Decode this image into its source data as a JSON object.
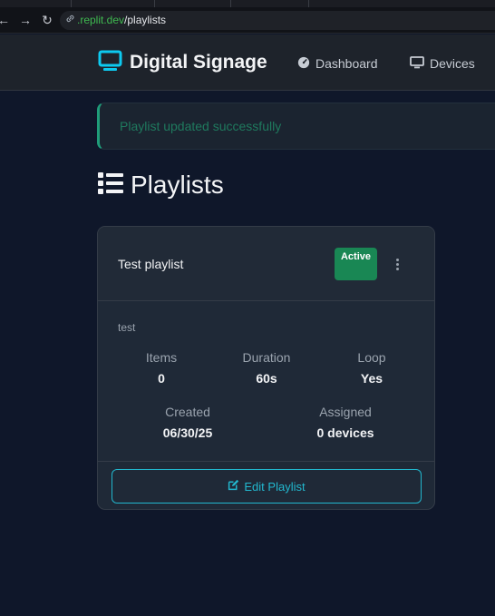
{
  "browser": {
    "url_host": ".replit.dev",
    "url_path": "/playlists"
  },
  "navbar": {
    "brand": "Digital Signage",
    "links": [
      {
        "label": "Dashboard",
        "icon": "dashboard-gauge-icon"
      },
      {
        "label": "Devices",
        "icon": "monitor-icon"
      }
    ]
  },
  "alert": {
    "message": "Playlist updated successfully"
  },
  "page": {
    "title": "Playlists"
  },
  "playlists": [
    {
      "name": "Test playlist",
      "status": "Active",
      "description": "test",
      "stats": [
        {
          "label": "Items",
          "value": "0"
        },
        {
          "label": "Duration",
          "value": "60s"
        },
        {
          "label": "Loop",
          "value": "Yes"
        },
        {
          "label": "Created",
          "value": "06/30/25"
        },
        {
          "label": "Assigned",
          "value": "0 devices"
        }
      ],
      "edit_label": "Edit Playlist"
    }
  ],
  "colors": {
    "background": "#0f172a",
    "brand_icon": "#0dcaf0",
    "badge_active": "#198754",
    "alert_border": "#1f9d7a",
    "button_outline": "#22b8cf"
  }
}
